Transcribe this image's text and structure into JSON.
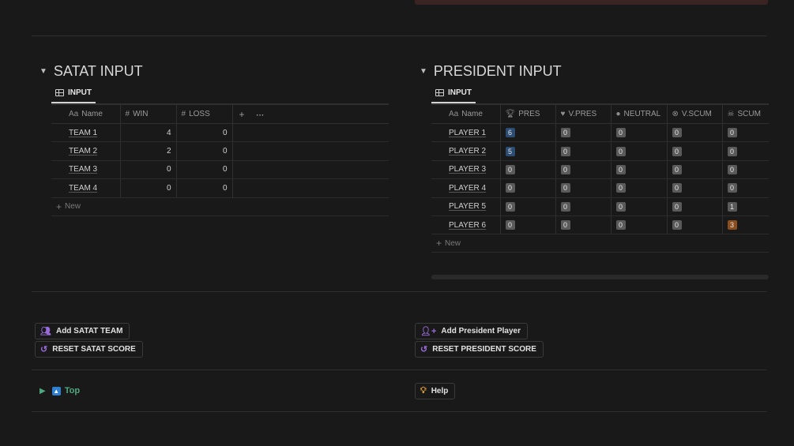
{
  "satat": {
    "title": "SATAT INPUT",
    "tab_label": "INPUT",
    "columns": [
      "Name",
      "WIN",
      "LOSS"
    ],
    "column_icons": [
      "Aa",
      "#",
      "#"
    ],
    "rows": [
      {
        "name": "TEAM 1",
        "win": "4",
        "loss": "0"
      },
      {
        "name": "TEAM 2",
        "win": "2",
        "loss": "0"
      },
      {
        "name": "TEAM 3",
        "win": "0",
        "loss": "0"
      },
      {
        "name": "TEAM 4",
        "win": "0",
        "loss": "0"
      }
    ],
    "add_col": "+",
    "more": "···",
    "new_label": "New"
  },
  "president": {
    "title": "PRESIDENT INPUT",
    "tab_label": "INPUT",
    "columns": [
      "Name",
      "PRES",
      "V.PRES",
      "NEUTRAL",
      "V.SCUM",
      "SCUM"
    ],
    "column_icons": [
      "Aa",
      "trophy-icon",
      "heart-icon",
      "exclamation-icon",
      "x-circle-icon",
      "skull-icon"
    ],
    "rows": [
      {
        "name": "PLAYER 1",
        "pres": "6",
        "vpres": "0",
        "neutral": "0",
        "vscum": "0",
        "scum": "0"
      },
      {
        "name": "PLAYER 2",
        "pres": "5",
        "vpres": "0",
        "neutral": "0",
        "vscum": "0",
        "scum": "0"
      },
      {
        "name": "PLAYER 3",
        "pres": "0",
        "vpres": "0",
        "neutral": "0",
        "vscum": "0",
        "scum": "0"
      },
      {
        "name": "PLAYER 4",
        "pres": "0",
        "vpres": "0",
        "neutral": "0",
        "vscum": "0",
        "scum": "0"
      },
      {
        "name": "PLAYER 5",
        "pres": "0",
        "vpres": "0",
        "neutral": "0",
        "vscum": "0",
        "scum": "1"
      },
      {
        "name": "PLAYER 6",
        "pres": "0",
        "vpres": "0",
        "neutral": "0",
        "vscum": "0",
        "scum": "3"
      }
    ],
    "new_label": "New"
  },
  "buttons": {
    "add_satat": "Add SATAT TEAM",
    "reset_satat": "RESET SATAT SCORE",
    "add_president": "Add President Player",
    "reset_president": "RESET PRESIDENT SCORE",
    "help": "Help"
  },
  "footer": {
    "top_label": "Top"
  },
  "colors": {
    "background": "#191919",
    "badge_blue": "#2c4c72",
    "badge_orange": "#8a4d1e",
    "badge_gray": "#5a5a5a",
    "link_green": "#4fa87f",
    "accent_purple": "#9a6bd8"
  }
}
